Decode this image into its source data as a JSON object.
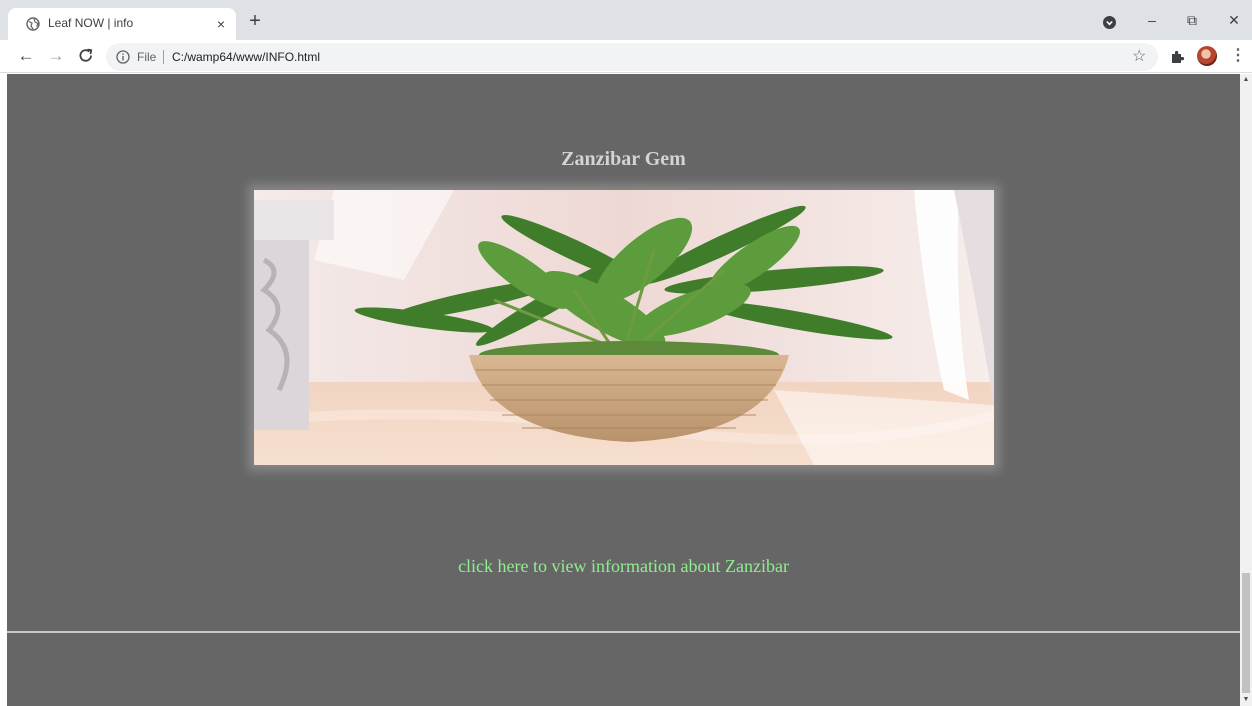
{
  "browser": {
    "tab": {
      "title": "Leaf NOW | info",
      "favicon": "globe-icon"
    },
    "new_tab_label": "+",
    "close_glyph": "×",
    "window_controls": {
      "minimize": "–",
      "restore": "⧉",
      "close": "✕"
    },
    "address": {
      "scheme_label": "File",
      "url": "C:/wamp64/www/INFO.html"
    }
  },
  "page": {
    "heading": "Zanzibar Gem",
    "link_text": "click here to view information about Zanzibar",
    "background_color": "#666666",
    "heading_color": "#d4d4d4",
    "link_color": "#90ee90"
  }
}
